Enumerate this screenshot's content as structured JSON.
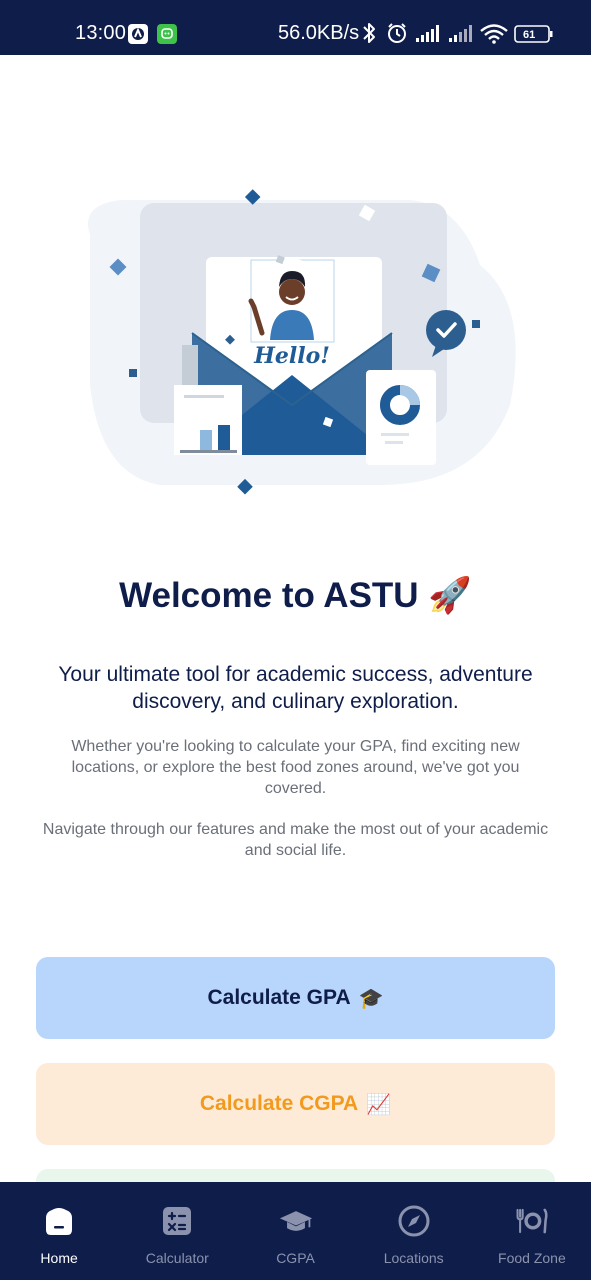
{
  "status_bar": {
    "time": "13:00",
    "network_speed": "56.0KB/s",
    "battery_level": "61"
  },
  "hero": {
    "greeting": "Hello!"
  },
  "welcome": {
    "title": "Welcome to ASTU",
    "title_emoji": "🚀",
    "tagline": "Your ultimate tool for academic success, adventure discovery, and culinary exploration.",
    "description": "Whether you're looking to calculate your GPA, find exciting new locations, or explore the best food zones around, we've got you covered.",
    "description_2": "Navigate through our features and make the most out of your academic and social life."
  },
  "actions": {
    "gpa_label": "Calculate GPA",
    "gpa_emoji": "🎓",
    "cgpa_label": "Calculate CGPA",
    "cgpa_emoji": "📈"
  },
  "bottom_nav": {
    "items": [
      {
        "label": "Home",
        "icon": "home-icon",
        "active": true
      },
      {
        "label": "Calculator",
        "icon": "calculator-icon",
        "active": false
      },
      {
        "label": "CGPA",
        "icon": "graduation-cap-icon",
        "active": false
      },
      {
        "label": "Locations",
        "icon": "compass-icon",
        "active": false
      },
      {
        "label": "Food Zone",
        "icon": "restaurant-icon",
        "active": false
      }
    ]
  },
  "colors": {
    "navy": "#0f1d4a",
    "gpa_button_bg": "#b8d5fb",
    "cgpa_button_bg": "#fdebd8",
    "cgpa_text": "#f29a1e",
    "illustration_blue": "#1f5b96"
  }
}
